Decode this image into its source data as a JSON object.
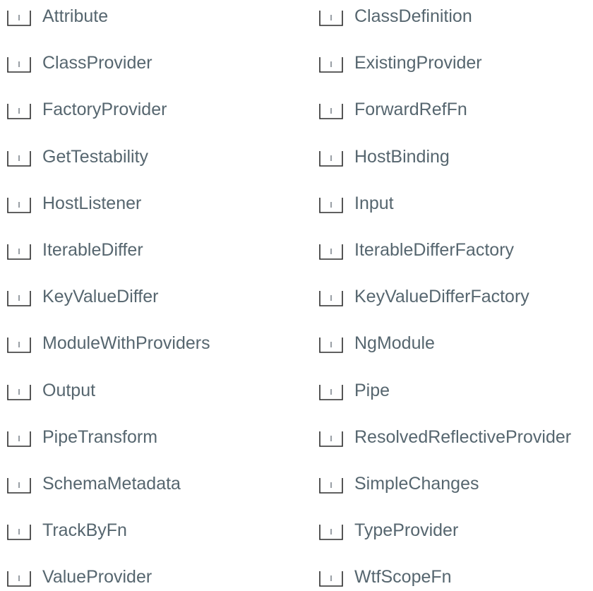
{
  "api_list": {
    "icon": "interface-icon",
    "icon_letter": "I",
    "colors": {
      "label": "#56666f",
      "icon_stroke": "#2b2b2b",
      "icon_letter": "#9aa0a6"
    },
    "items": [
      {
        "label": "Attribute",
        "column": 0,
        "row": 0
      },
      {
        "label": "ClassDefinition",
        "column": 1,
        "row": 0
      },
      {
        "label": "ClassProvider",
        "column": 0,
        "row": 1
      },
      {
        "label": "ExistingProvider",
        "column": 1,
        "row": 1
      },
      {
        "label": "FactoryProvider",
        "column": 0,
        "row": 2
      },
      {
        "label": "ForwardRefFn",
        "column": 1,
        "row": 2
      },
      {
        "label": "GetTestability",
        "column": 0,
        "row": 3
      },
      {
        "label": "HostBinding",
        "column": 1,
        "row": 3
      },
      {
        "label": "HostListener",
        "column": 0,
        "row": 4
      },
      {
        "label": "Input",
        "column": 1,
        "row": 4
      },
      {
        "label": "IterableDiffer",
        "column": 0,
        "row": 5
      },
      {
        "label": "IterableDifferFactory",
        "column": 1,
        "row": 5
      },
      {
        "label": "KeyValueDiffer",
        "column": 0,
        "row": 6
      },
      {
        "label": "KeyValueDifferFactory",
        "column": 1,
        "row": 6
      },
      {
        "label": "ModuleWithProviders",
        "column": 0,
        "row": 7
      },
      {
        "label": "NgModule",
        "column": 1,
        "row": 7
      },
      {
        "label": "Output",
        "column": 0,
        "row": 8
      },
      {
        "label": "Pipe",
        "column": 1,
        "row": 8
      },
      {
        "label": "PipeTransform",
        "column": 0,
        "row": 9
      },
      {
        "label": "ResolvedReflectiveProvider",
        "column": 1,
        "row": 9
      },
      {
        "label": "SchemaMetadata",
        "column": 0,
        "row": 10
      },
      {
        "label": "SimpleChanges",
        "column": 1,
        "row": 10
      },
      {
        "label": "TrackByFn",
        "column": 0,
        "row": 11
      },
      {
        "label": "TypeProvider",
        "column": 1,
        "row": 11
      },
      {
        "label": "ValueProvider",
        "column": 0,
        "row": 12
      },
      {
        "label": "WtfScopeFn",
        "column": 1,
        "row": 12
      }
    ]
  }
}
